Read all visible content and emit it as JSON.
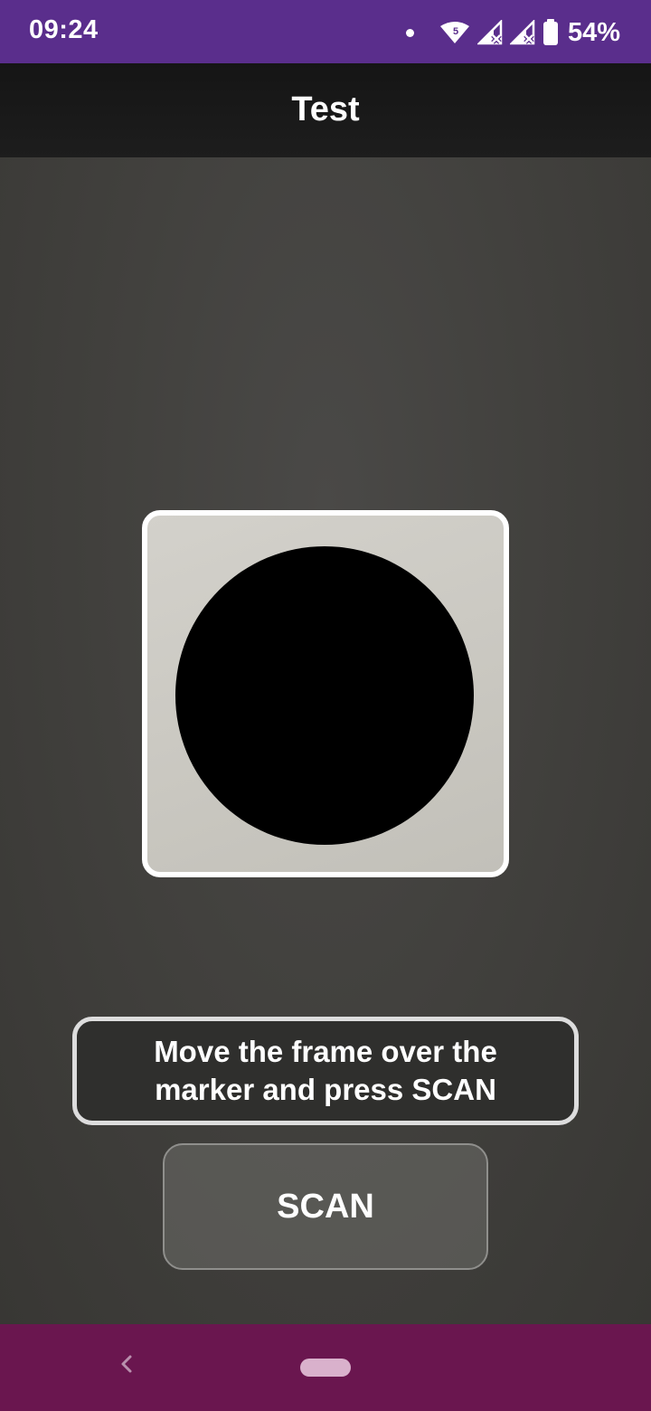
{
  "status_bar": {
    "time": "09:24",
    "network_badge": "5",
    "battery_percent": "54%",
    "icons": [
      "notification-dot-icon",
      "wifi-icon",
      "signal-no-service-icon",
      "signal-no-service-icon",
      "battery-icon"
    ]
  },
  "app_bar": {
    "title": "Test"
  },
  "scanner": {
    "frame_color": "#ffffff",
    "marker_shape": "circle",
    "marker_color": "#000000"
  },
  "instruction": {
    "text": "Move the frame over the marker and press SCAN"
  },
  "scan_button": {
    "label": "SCAN"
  },
  "navigation": {
    "back_icon": "back-chevron-icon",
    "home_icon": "home-pill-icon"
  },
  "colors": {
    "status_bar": "#5a2e8c",
    "nav_bar": "#6a164f",
    "app_bar": "#1a1a1a"
  }
}
